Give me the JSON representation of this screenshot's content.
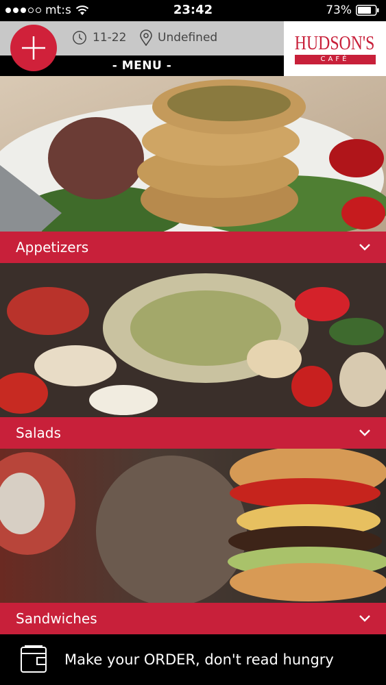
{
  "status_bar": {
    "carrier": "mt:s",
    "time": "23:42",
    "battery": "73%"
  },
  "header": {
    "hours": "11-22",
    "location": "Undefined",
    "logo_main": "HUDSON'S",
    "logo_sub": "CAFÉ",
    "menu_title": "- MENU -"
  },
  "categories": [
    {
      "label": "Appetizers"
    },
    {
      "label": "Salads"
    },
    {
      "label": "Sandwiches"
    }
  ],
  "footer": {
    "text": "Make your ORDER, don't read hungry"
  },
  "colors": {
    "brand_red": "#c8203a",
    "header_gray": "#c8c8c8"
  }
}
